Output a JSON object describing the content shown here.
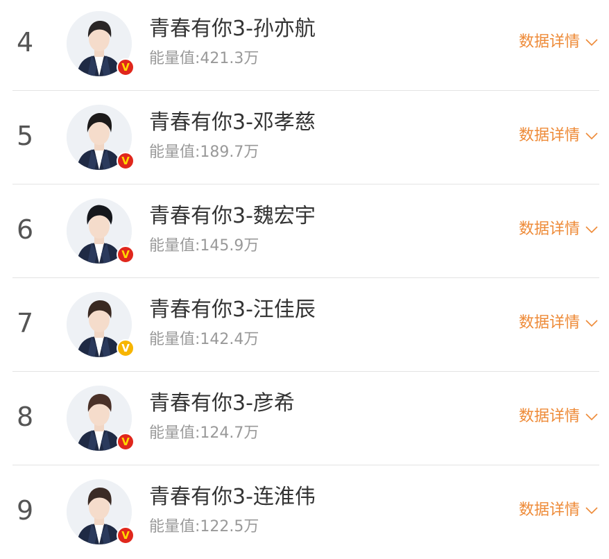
{
  "detail_label": "数据详情",
  "energy_prefix": "能量值:",
  "verified_badge": "V",
  "colors": {
    "accent": "#ee8a37",
    "rank": "#555555",
    "name": "#333333",
    "energy": "#999999",
    "divider": "#e3e3e3",
    "badge_red": "#e0271c",
    "badge_gold": "#f7b500"
  },
  "items": [
    {
      "rank": "4",
      "name": "青春有你3-孙亦航",
      "energy": "能量值:421.3万",
      "badge": "red"
    },
    {
      "rank": "5",
      "name": "青春有你3-邓孝慈",
      "energy": "能量值:189.7万",
      "badge": "red"
    },
    {
      "rank": "6",
      "name": "青春有你3-魏宏宇",
      "energy": "能量值:145.9万",
      "badge": "red"
    },
    {
      "rank": "7",
      "name": "青春有你3-汪佳辰",
      "energy": "能量值:142.4万",
      "badge": "gold"
    },
    {
      "rank": "8",
      "name": "青春有你3-彦希",
      "energy": "能量值:124.7万",
      "badge": "red"
    },
    {
      "rank": "9",
      "name": "青春有你3-连淮伟",
      "energy": "能量值:122.5万",
      "badge": "red"
    }
  ]
}
